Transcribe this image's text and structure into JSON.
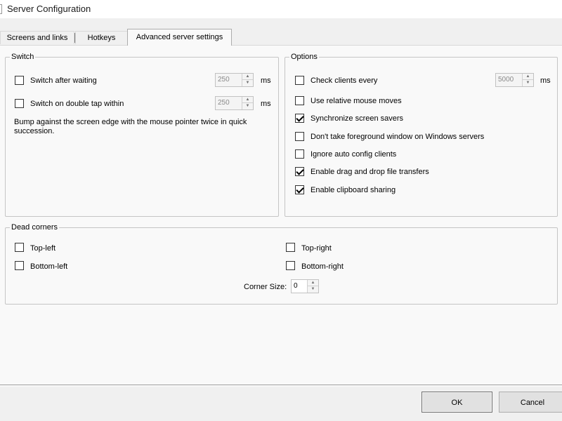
{
  "window": {
    "title": "Server Configuration"
  },
  "tabs": [
    {
      "label": "Screens and links",
      "active": false
    },
    {
      "label": "Hotkeys",
      "active": false
    },
    {
      "label": "Advanced server settings",
      "active": true
    }
  ],
  "switch_group": {
    "title": "Switch",
    "switch_after_waiting": {
      "label": "Switch after waiting",
      "checked": false,
      "value": "250",
      "unit": "ms"
    },
    "switch_double_tap": {
      "label": "Switch on double tap within",
      "checked": false,
      "value": "250",
      "unit": "ms"
    },
    "description": "Bump against the screen edge with the mouse pointer twice in quick succession."
  },
  "options_group": {
    "title": "Options",
    "check_clients": {
      "label": "Check clients every",
      "checked": false,
      "value": "5000",
      "unit": "ms"
    },
    "items": [
      {
        "label": "Use relative mouse moves",
        "checked": false
      },
      {
        "label": "Synchronize screen savers",
        "checked": true
      },
      {
        "label": "Don't take foreground window on Windows servers",
        "checked": false
      },
      {
        "label": "Ignore auto config clients",
        "checked": false
      },
      {
        "label": "Enable drag and drop file transfers",
        "checked": true
      },
      {
        "label": "Enable clipboard sharing",
        "checked": true
      }
    ]
  },
  "dead_corners": {
    "title": "Dead corners",
    "top_left": {
      "label": "Top-left",
      "checked": false
    },
    "top_right": {
      "label": "Top-right",
      "checked": false
    },
    "bottom_left": {
      "label": "Bottom-left",
      "checked": false
    },
    "bottom_right": {
      "label": "Bottom-right",
      "checked": false
    },
    "corner_size": {
      "label": "Corner Size:",
      "value": "0"
    }
  },
  "buttons": {
    "ok": "OK",
    "cancel": "Cancel"
  }
}
